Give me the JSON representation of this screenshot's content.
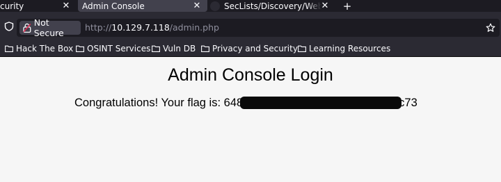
{
  "tabs": [
    {
      "title": "curity",
      "active": false
    },
    {
      "title": "Admin Console",
      "active": true
    },
    {
      "title": "SecLists/Discovery/Web-C",
      "active": false
    }
  ],
  "new_tab_label": "+",
  "address_bar": {
    "security_label": "Not Secure",
    "url_scheme": "http://",
    "url_host": "10.129.7.118",
    "url_path": "/admin.php"
  },
  "bookmarks": [
    "Hack The Box",
    "OSINT Services",
    "Vuln DB",
    "Privacy and Security",
    "Learning Resources"
  ],
  "page": {
    "heading": "Admin Console Login",
    "flag_prefix": "Congratulations! Your flag is: 648",
    "flag_suffix": "c73"
  },
  "colors": {
    "tabstrip_bg": "#1c1b22",
    "toolbar_bg": "#2b2a33",
    "page_bg": "#f6f6f6"
  },
  "icons": [
    "close-icon",
    "plus-icon",
    "shield-icon",
    "lock-warning-icon",
    "star-icon",
    "folder-icon",
    "github-icon"
  ]
}
